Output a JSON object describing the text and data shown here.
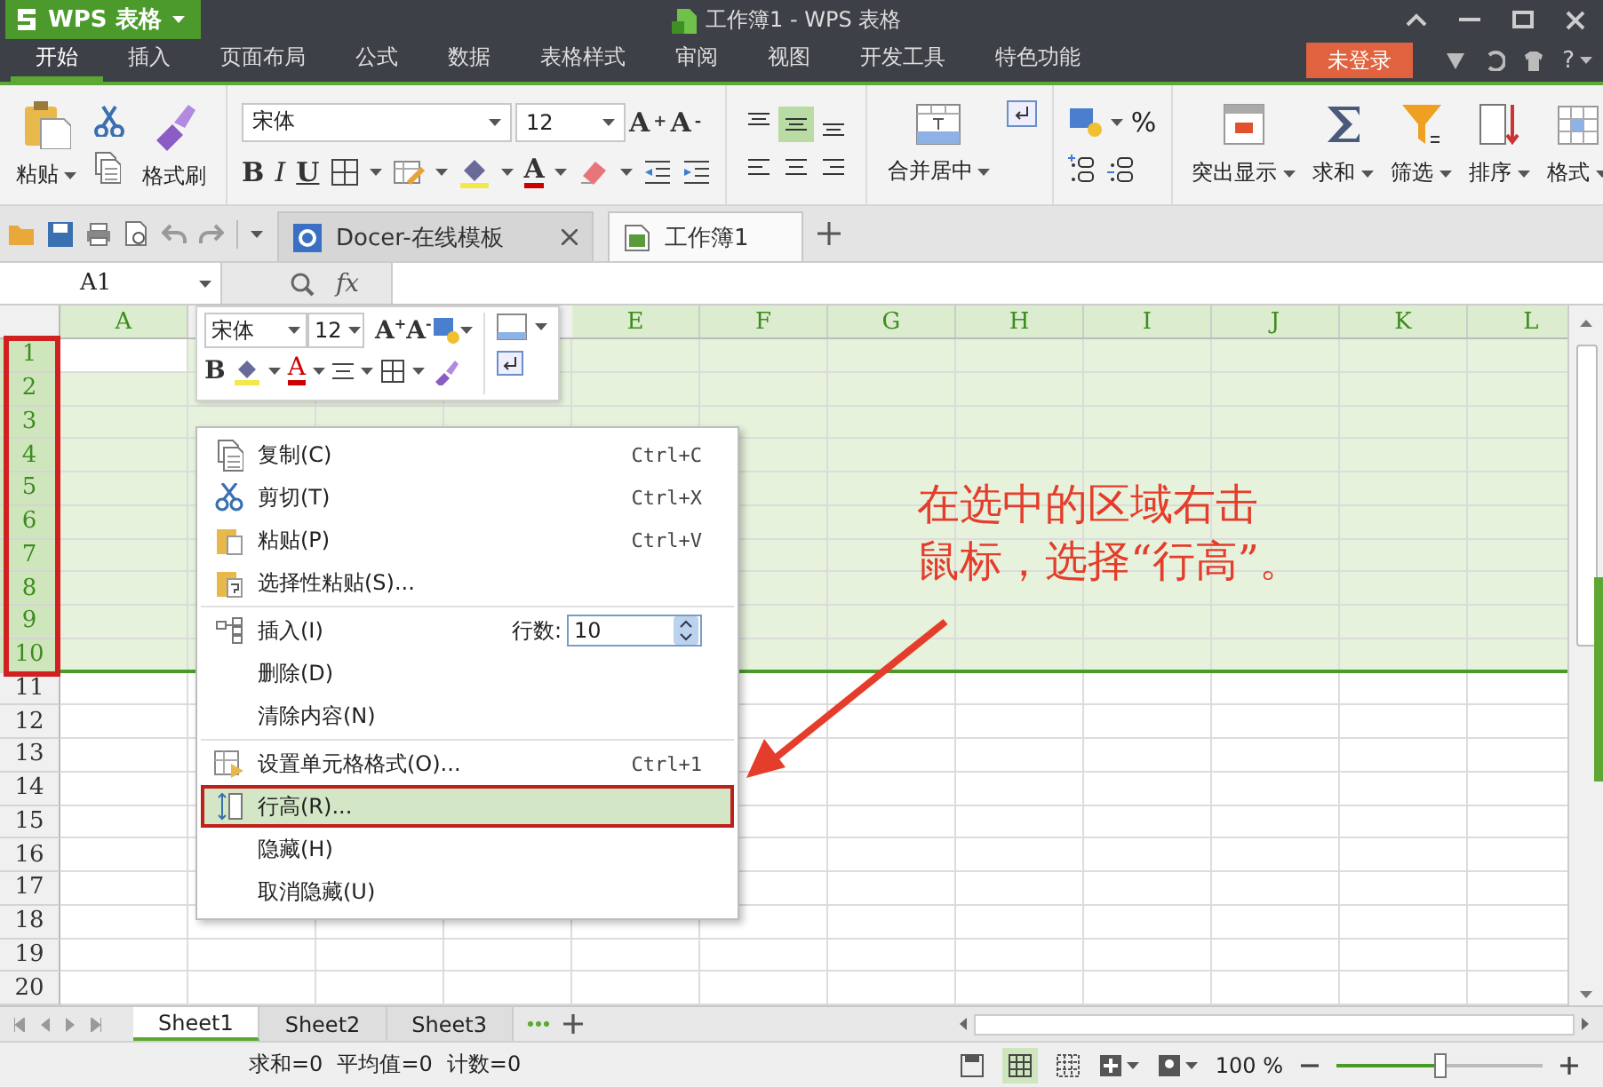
{
  "app_menu": {
    "label": "WPS 表格"
  },
  "window": {
    "title": "工作簿1 - WPS 表格"
  },
  "menu_tabs": [
    {
      "label": "开始",
      "selected": true
    },
    {
      "label": "插入",
      "selected": false
    },
    {
      "label": "页面布局",
      "selected": false
    },
    {
      "label": "公式",
      "selected": false
    },
    {
      "label": "数据",
      "selected": false
    },
    {
      "label": "表格样式",
      "selected": false
    },
    {
      "label": "审阅",
      "selected": false
    },
    {
      "label": "视图",
      "selected": false
    },
    {
      "label": "开发工具",
      "selected": false
    },
    {
      "label": "特色功能",
      "selected": false
    }
  ],
  "login_button": {
    "label": "未登录"
  },
  "help_button": {
    "label": "?"
  },
  "ribbon": {
    "paste": "粘贴",
    "format_painter": "格式刷",
    "font_name": "宋体",
    "font_size": "12",
    "grow_font": "A$^{+}$",
    "shrink_font": "A$^{-}$",
    "bold": "B",
    "italic": "I",
    "underline": "U",
    "font_color": "A",
    "merge_center": "合并居中",
    "percent": "%",
    "big_buttons": [
      {
        "label": "突出显示"
      },
      {
        "label": "求和"
      },
      {
        "label": "筛选"
      },
      {
        "label": "排序"
      },
      {
        "label": "格式"
      }
    ]
  },
  "doc_tabs": [
    {
      "label": "Docer-在线模板",
      "selected": false
    },
    {
      "label": "工作簿1",
      "selected": true
    }
  ],
  "formula_bar": {
    "name_box": "A1",
    "fx": "fx"
  },
  "columns_left": [
    "A"
  ],
  "columns_right": [
    "E",
    "F",
    "G",
    "H",
    "I",
    "J",
    "K",
    "L"
  ],
  "rows": [
    {
      "label": "1",
      "selected": true
    },
    {
      "label": "2",
      "selected": true
    },
    {
      "label": "3",
      "selected": true
    },
    {
      "label": "4",
      "selected": true
    },
    {
      "label": "5",
      "selected": true
    },
    {
      "label": "6",
      "selected": true
    },
    {
      "label": "7",
      "selected": true
    },
    {
      "label": "8",
      "selected": true
    },
    {
      "label": "9",
      "selected": true
    },
    {
      "label": "10",
      "selected": true
    },
    {
      "label": "11",
      "selected": false
    },
    {
      "label": "12",
      "selected": false
    },
    {
      "label": "13",
      "selected": false
    },
    {
      "label": "14",
      "selected": false
    },
    {
      "label": "15",
      "selected": false
    },
    {
      "label": "16",
      "selected": false
    },
    {
      "label": "17",
      "selected": false
    },
    {
      "label": "18",
      "selected": false
    },
    {
      "label": "19",
      "selected": false
    },
    {
      "label": "20",
      "selected": false
    }
  ],
  "mini_toolbar": {
    "font_name": "宋体",
    "font_size": "12",
    "grow_font": "A$^{+}$",
    "shrink_font": "A$^{-}$",
    "bold": "B",
    "font_color": "A"
  },
  "context_menu": {
    "groups": [
      [
        {
          "kind": "command",
          "label": "复制(C)",
          "shortcut": "Ctrl+C",
          "highlighted": false
        },
        {
          "kind": "command",
          "label": "剪切(T)",
          "shortcut": "Ctrl+X",
          "highlighted": false
        },
        {
          "kind": "command",
          "label": "粘贴(P)",
          "shortcut": "Ctrl+V",
          "highlighted": false
        },
        {
          "kind": "command",
          "label": "选择性粘贴(S)...",
          "highlighted": false
        }
      ],
      [
        {
          "kind": "insert",
          "label": "插入(I)",
          "count_label": "行数:",
          "count_value": "10",
          "highlighted": false
        },
        {
          "kind": "command",
          "label": "删除(D)",
          "highlighted": false
        },
        {
          "kind": "command",
          "label": "清除内容(N)",
          "highlighted": false
        }
      ],
      [
        {
          "kind": "command",
          "label": "设置单元格格式(O)...",
          "shortcut": "Ctrl+1",
          "highlighted": false
        },
        {
          "kind": "command",
          "label": "行高(R)...",
          "highlighted": true
        },
        {
          "kind": "command",
          "label": "隐藏(H)",
          "highlighted": false
        },
        {
          "kind": "command",
          "label": "取消隐藏(U)",
          "highlighted": false
        }
      ]
    ]
  },
  "annotation": {
    "lines": [
      "在选中的区域右击",
      "鼠标，选择“行高”。"
    ]
  },
  "sheet_tabs": [
    {
      "label": "Sheet1",
      "selected": true
    },
    {
      "label": "Sheet2",
      "selected": false
    },
    {
      "label": "Sheet3",
      "selected": false
    }
  ],
  "status_bar": {
    "summary": [
      "求和=0",
      "平均值=0",
      "计数=0"
    ],
    "zoom": "100 %",
    "zoom_slider": {
      "level": 0.5
    }
  }
}
